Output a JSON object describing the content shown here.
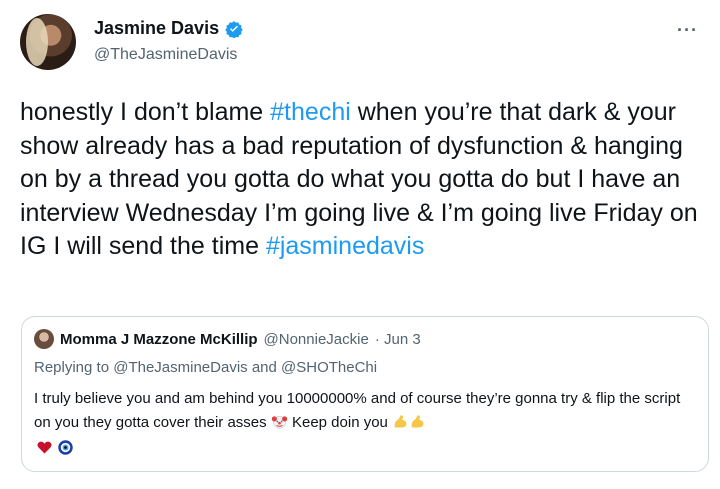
{
  "author": {
    "display_name": "Jasmine Davis",
    "handle": "@TheJasmineDavis",
    "verified": true
  },
  "more_label": "···",
  "tweet": {
    "segments": [
      {
        "text": "honestly I don’t blame ",
        "type": "text"
      },
      {
        "text": "#thechi",
        "type": "hashtag"
      },
      {
        "text": " when you’re that dark & your show already has a bad reputation of dysfunction & hanging on by a thread you gotta do what you gotta do but I have an interview Wednesday I’m going live & I’m going live Friday on IG I will send the time ",
        "type": "text"
      },
      {
        "text": "#jasminedavis",
        "type": "hashtag"
      }
    ]
  },
  "quoted": {
    "display_name": "Momma J Mazzone McKillip",
    "handle": "@NonnieJackie",
    "date": "· Jun 3",
    "reply_prefix": "Replying to",
    "reply_mentions": "@TheJasmineDavis and @SHOTheChi",
    "text_part1": "I truly believe you and am behind you 10000000% and of course they’re gonna try & flip the script on you they gotta cover their asses",
    "text_part2": " Keep doin you",
    "emojis": [
      "clown-face",
      "flexed-biceps",
      "flexed-biceps",
      "red-heart",
      "nazar-amulet"
    ]
  },
  "colors": {
    "accent": "#1d9bf0",
    "text": "#0f1419",
    "muted": "#536471",
    "border": "#cfd9de"
  }
}
